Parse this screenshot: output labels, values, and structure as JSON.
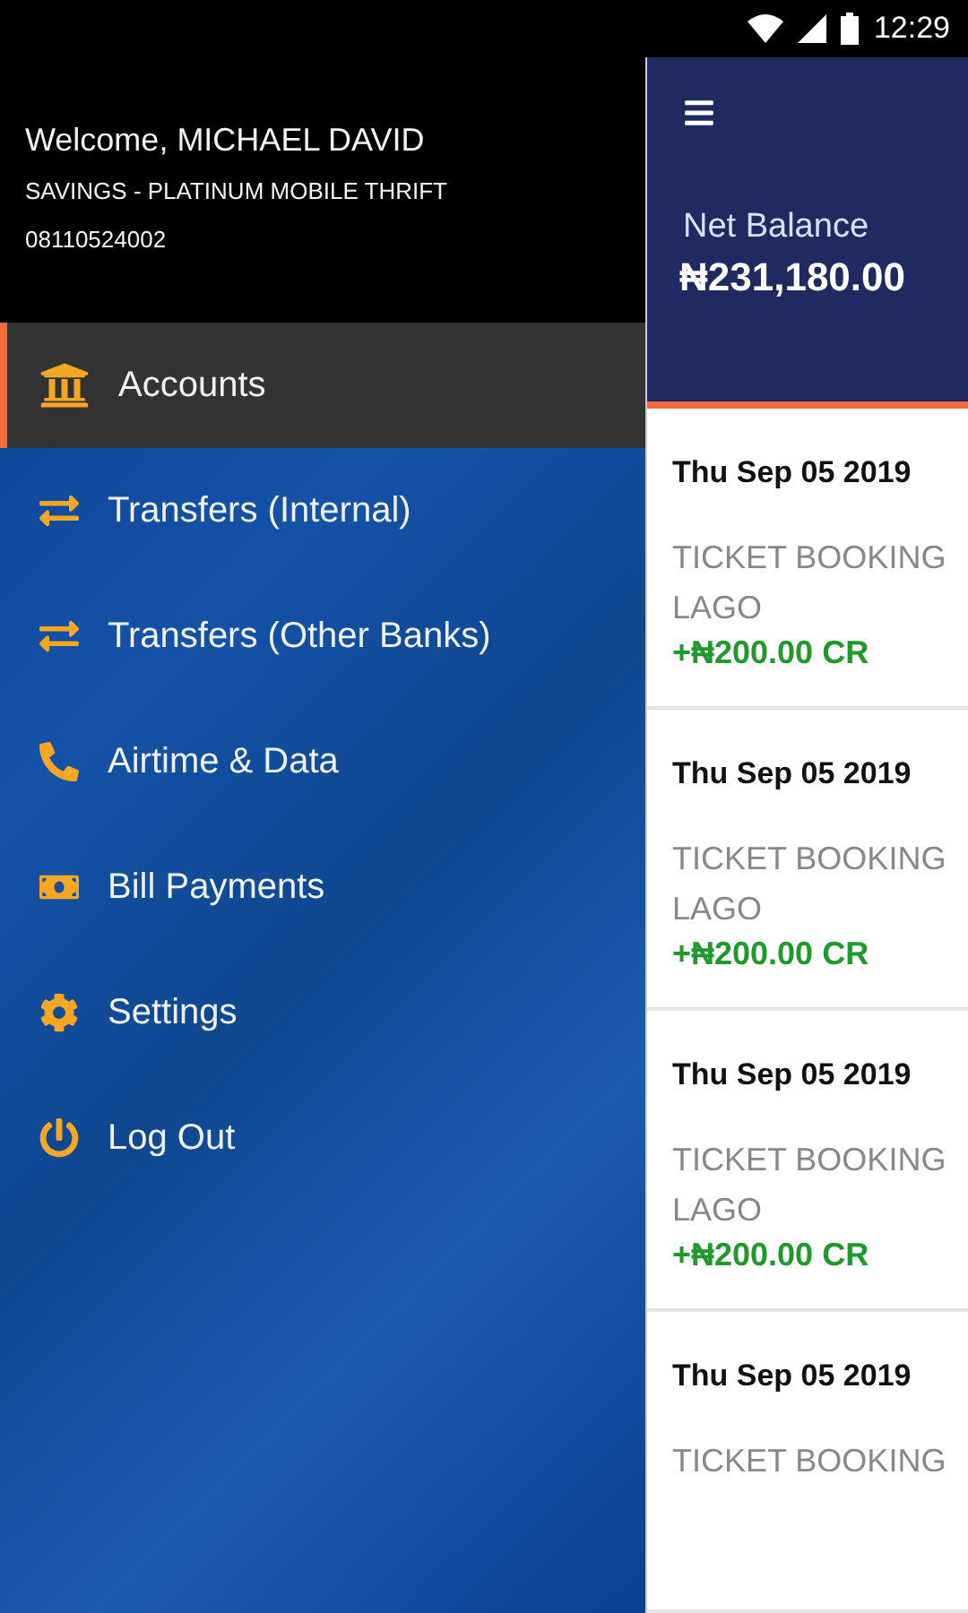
{
  "status_bar": {
    "time": "12:29"
  },
  "drawer": {
    "welcome": "Welcome, MICHAEL DAVID",
    "account_type": "SAVINGS - PLATINUM MOBILE THRIFT",
    "account_number": "08110524002",
    "items": [
      {
        "label": "Accounts",
        "selected": true
      },
      {
        "label": "Transfers (Internal)",
        "selected": false
      },
      {
        "label": "Transfers (Other Banks)",
        "selected": false
      },
      {
        "label": "Airtime & Data",
        "selected": false
      },
      {
        "label": "Bill Payments",
        "selected": false
      },
      {
        "label": "Settings",
        "selected": false
      },
      {
        "label": "Log Out",
        "selected": false
      }
    ]
  },
  "header": {
    "balance_label": "Net Balance",
    "balance": "₦231,180.00"
  },
  "transactions": [
    {
      "date": "Thu Sep 05 2019",
      "description": "TICKET BOOKING LAGO",
      "amount": "+₦200.00 CR"
    },
    {
      "date": "Thu Sep 05 2019",
      "description": "TICKET BOOKING LAGO",
      "amount": "+₦200.00 CR"
    },
    {
      "date": "Thu Sep 05 2019",
      "description": "TICKET BOOKING LAGO",
      "amount": "+₦200.00 CR"
    },
    {
      "date": "Thu Sep 05 2019",
      "description": "TICKET BOOKING"
    }
  ]
}
